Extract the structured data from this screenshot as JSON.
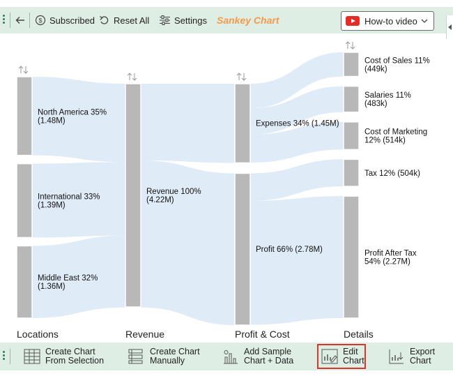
{
  "toolbar": {
    "subscribed_label": "Subscribed",
    "reset_label": "Reset All",
    "settings_label": "Settings",
    "brand_label": "Sankey Chart",
    "howto_label": "How-to video"
  },
  "bottom_toolbar": {
    "create_from_selection_label": "Create Chart\nFrom Selection",
    "create_manually_label": "Create Chart\nManually",
    "add_sample_label": "Add Sample\nChart + Data",
    "edit_chart_label": "Edit\nChart",
    "export_chart_label": "Export\nChart"
  },
  "colors": {
    "node": "#b8b8b8",
    "link": "#c5daf0",
    "toolbar_bg": "#dfeee4",
    "brand": "#f39a4b",
    "selected_border": "#d9362b"
  },
  "chart_data": {
    "type": "sankey",
    "stages": [
      "Locations",
      "Revenue",
      "Profit & Cost",
      "Details"
    ],
    "nodes": [
      {
        "id": "na",
        "stage": 0,
        "label_line1": "North America 35%",
        "label_line2": "(1.48M)",
        "value": 1.48
      },
      {
        "id": "intl",
        "stage": 0,
        "label_line1": "International 33%",
        "label_line2": "(1.39M)",
        "value": 1.39
      },
      {
        "id": "me",
        "stage": 0,
        "label_line1": "Middle East 32%",
        "label_line2": "(1.36M)",
        "value": 1.36
      },
      {
        "id": "rev",
        "stage": 1,
        "label_line1": "Revenue 100%",
        "label_line2": "(4.22M)",
        "value": 4.22
      },
      {
        "id": "exp",
        "stage": 2,
        "label_line1": "Expenses 34% (1.45M)",
        "label_line2": "",
        "value": 1.45
      },
      {
        "id": "profit",
        "stage": 2,
        "label_line1": "Profit 66% (2.78M)",
        "label_line2": "",
        "value": 2.78
      },
      {
        "id": "cos",
        "stage": 3,
        "label_line1": "Cost of Sales 11%",
        "label_line2": "(449k)",
        "value": 0.449
      },
      {
        "id": "sal",
        "stage": 3,
        "label_line1": "Salaries 11%",
        "label_line2": "(483k)",
        "value": 0.483
      },
      {
        "id": "mkt",
        "stage": 3,
        "label_line1": "Cost of Marketing",
        "label_line2": "12% (514k)",
        "value": 0.514
      },
      {
        "id": "tax",
        "stage": 3,
        "label_line1": "Tax 12% (504k)",
        "label_line2": "",
        "value": 0.504
      },
      {
        "id": "pat",
        "stage": 3,
        "label_line1": "Profit After Tax",
        "label_line2": "54% (2.27M)",
        "value": 2.27
      }
    ],
    "links": [
      {
        "source": "na",
        "target": "rev",
        "value": 1.48
      },
      {
        "source": "intl",
        "target": "rev",
        "value": 1.39
      },
      {
        "source": "me",
        "target": "rev",
        "value": 1.36
      },
      {
        "source": "rev",
        "target": "exp",
        "value": 1.45
      },
      {
        "source": "rev",
        "target": "profit",
        "value": 2.78
      },
      {
        "source": "exp",
        "target": "cos",
        "value": 0.449
      },
      {
        "source": "exp",
        "target": "sal",
        "value": 0.483
      },
      {
        "source": "exp",
        "target": "mkt",
        "value": 0.514
      },
      {
        "source": "profit",
        "target": "tax",
        "value": 0.504
      },
      {
        "source": "profit",
        "target": "pat",
        "value": 2.27
      }
    ]
  }
}
